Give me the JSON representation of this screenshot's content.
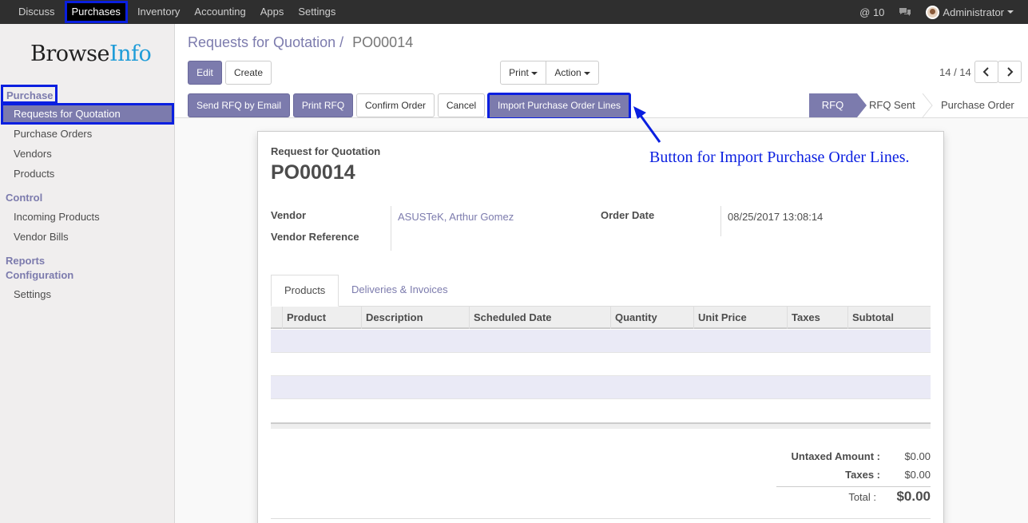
{
  "topbar": {
    "menus": [
      "Discuss",
      "Purchases",
      "Inventory",
      "Accounting",
      "Apps",
      "Settings"
    ],
    "active_menu": "Purchases",
    "mentions": "@ 10",
    "user": "Administrator"
  },
  "sidebar": {
    "logo_a": "Browse",
    "logo_b": "Info",
    "section_purchase": "Purchase",
    "items_purchase": [
      "Requests for Quotation",
      "Purchase Orders",
      "Vendors",
      "Products"
    ],
    "section_control": "Control",
    "items_control": [
      "Incoming Products",
      "Vendor Bills"
    ],
    "section_reports": "Reports",
    "section_config": "Configuration",
    "items_config": [
      "Settings"
    ]
  },
  "breadcrumb": {
    "parent": "Requests for Quotation",
    "sep": "/",
    "current": "PO00014"
  },
  "buttons": {
    "edit": "Edit",
    "create": "Create",
    "print": "Print",
    "action": "Action",
    "send_rfq": "Send RFQ by Email",
    "print_rfq": "Print RFQ",
    "confirm": "Confirm Order",
    "cancel": "Cancel",
    "import_lines": "Import Purchase Order Lines"
  },
  "pager": {
    "text": "14 / 14"
  },
  "status_stages": [
    "RFQ",
    "RFQ Sent",
    "Purchase Order"
  ],
  "annotation": "Button for Import Purchase Order Lines.",
  "form": {
    "doc_label": "Request for Quotation",
    "doc_number": "PO00014",
    "vendor_label": "Vendor",
    "vendor_value": "ASUSTeK, Arthur Gomez",
    "vendor_ref_label": "Vendor Reference",
    "order_date_label": "Order Date",
    "order_date_value": "08/25/2017 13:08:14"
  },
  "tabs": [
    "Products",
    "Deliveries & Invoices"
  ],
  "table": {
    "columns": [
      "Product",
      "Description",
      "Scheduled Date",
      "Quantity",
      "Unit Price",
      "Taxes",
      "Subtotal"
    ]
  },
  "totals": {
    "untaxed_label": "Untaxed Amount :",
    "untaxed_value": "$0.00",
    "taxes_label": "Taxes :",
    "taxes_value": "$0.00",
    "total_label": "Total :",
    "total_value": "$0.00"
  },
  "colors": {
    "primary": "#7c7bad",
    "highlight": "#0a1fe0",
    "navbar": "#2f2f2f"
  }
}
